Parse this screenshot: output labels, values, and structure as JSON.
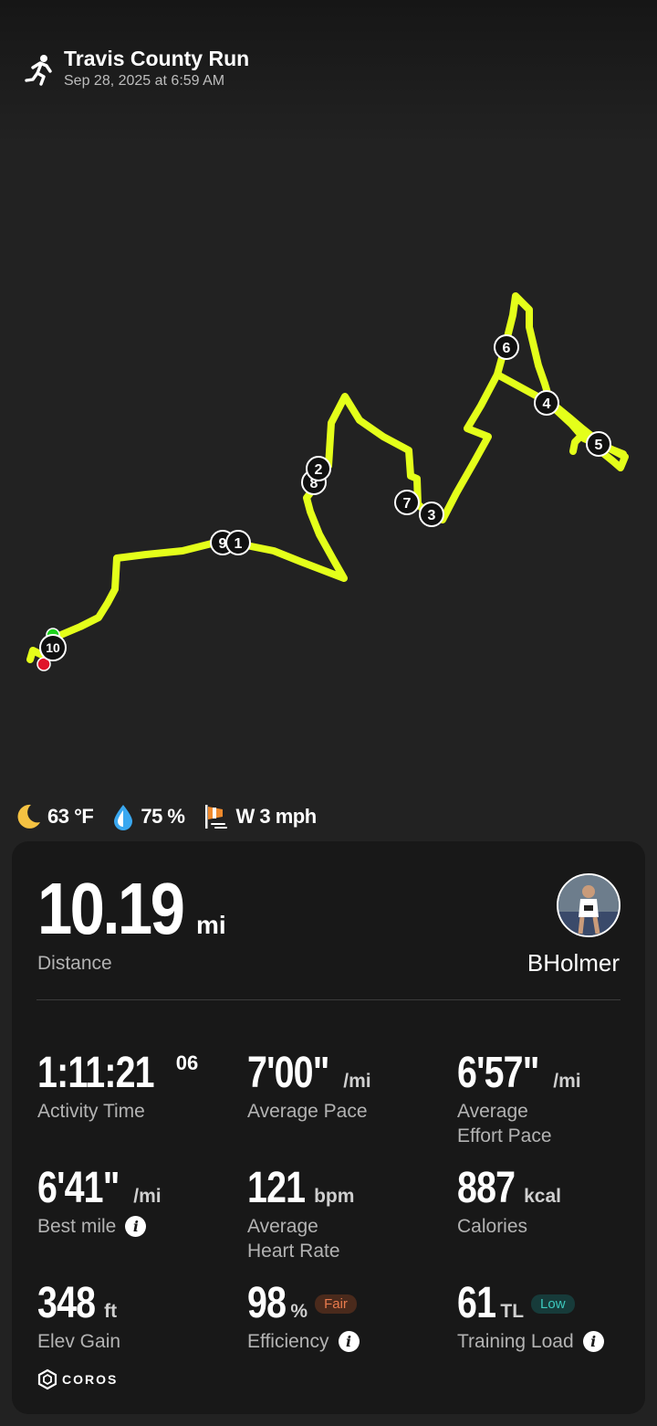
{
  "activity": {
    "title": "Travis County Run",
    "datetime": "Sep 28, 2025 at 6:59 AM"
  },
  "map": {
    "route_color": "#e4ff1a",
    "start_color": "#1fd21f",
    "end_color": "#e0142a",
    "mile_markers": [
      "1",
      "2",
      "3",
      "4",
      "5",
      "6",
      "7",
      "8",
      "9",
      "10"
    ]
  },
  "weather": {
    "temperature": "63 °F",
    "humidity": "75 %",
    "wind": "W 3 mph",
    "icons": [
      "moon-icon",
      "humidity-drop-icon",
      "wind-sock-icon"
    ]
  },
  "summary": {
    "distance_value": "10.19",
    "distance_unit": "mi",
    "distance_label": "Distance",
    "username": "BHolmer"
  },
  "stats": {
    "activity_time": {
      "value": "1:11:21",
      "sup": "06",
      "label": "Activity Time"
    },
    "average_pace": {
      "value": "7'00\"",
      "unit": "/mi",
      "label": "Average Pace"
    },
    "average_effort_pace": {
      "value": "6'57\"",
      "unit": "/mi",
      "label_line1": "Average",
      "label_line2": "Effort Pace"
    },
    "best_mile": {
      "value": "6'41\"",
      "unit": "/mi",
      "label": "Best mile"
    },
    "average_heart_rate": {
      "value": "121",
      "unit": "bpm",
      "label_line1": "Average",
      "label_line2": "Heart Rate"
    },
    "calories": {
      "value": "887",
      "unit": "kcal",
      "label": "Calories"
    },
    "elev_gain": {
      "value": "348",
      "unit": "ft",
      "label": "Elev Gain"
    },
    "efficiency": {
      "value": "98",
      "unit": "%",
      "badge": "Fair",
      "label": "Efficiency"
    },
    "training_load": {
      "value": "61",
      "unit": "TL",
      "badge": "Low",
      "label": "Training Load"
    }
  },
  "brand": {
    "name": "COROS"
  }
}
